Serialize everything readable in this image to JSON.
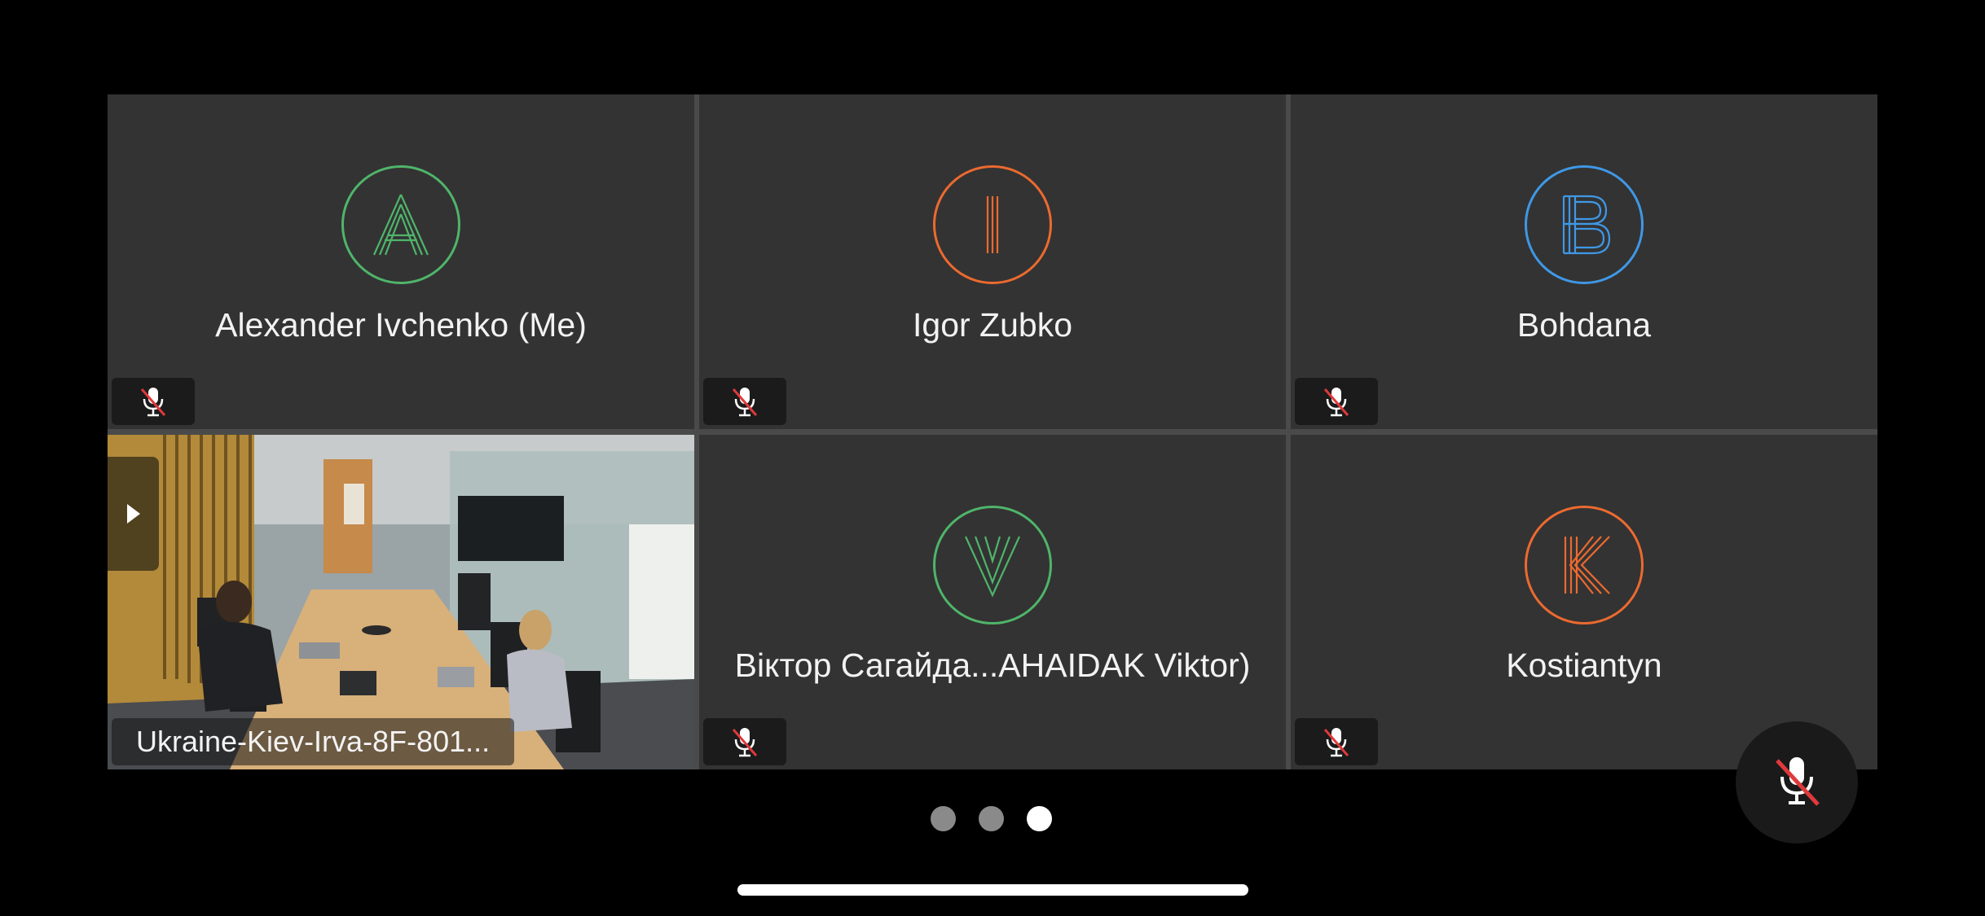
{
  "participants": [
    {
      "name": "Alexander Ivchenko (Me)",
      "initial": "A",
      "color": "#4fb56a",
      "muted": true
    },
    {
      "name": "Igor Zubko",
      "initial": "I",
      "color": "#ec6a2f",
      "muted": true
    },
    {
      "name": "Bohdana",
      "initial": "B",
      "color": "#3f98e6",
      "muted": true
    },
    {
      "name": "Ukraine-Kiev-Irva-8F-801...",
      "video": true,
      "active_speaker_color": "#56c05a"
    },
    {
      "name": "Віктор Сагайда...AHAIDAK Viktor)",
      "initial": "V",
      "color": "#4fb56a",
      "muted": true
    },
    {
      "name": "Kostiantyn",
      "initial": "K",
      "color": "#ec6a2f",
      "muted": true
    }
  ],
  "pagination": {
    "pages": 3,
    "current": 3
  },
  "controls": {
    "mic_state": "muted",
    "mute_color": "#e0393b"
  }
}
